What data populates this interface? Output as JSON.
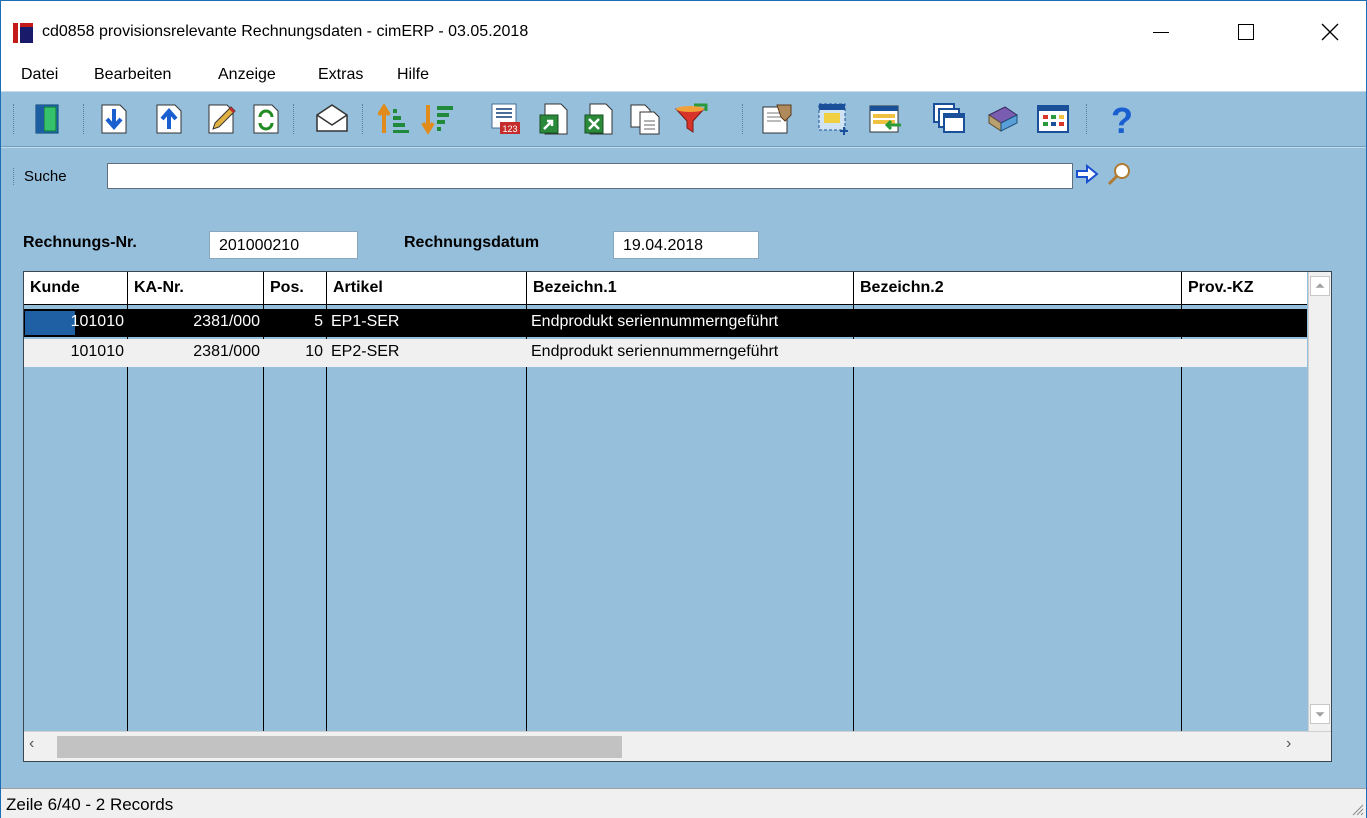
{
  "window": {
    "title": "cd0858 provisionsrelevante Rechnungsdaten - cimERP - 03.05.2018"
  },
  "menu": {
    "items": [
      {
        "label": "Datei"
      },
      {
        "label": "Bearbeiten"
      },
      {
        "label": "Anzeige"
      },
      {
        "label": "Extras"
      },
      {
        "label": "Hilfe"
      }
    ]
  },
  "toolbar": {
    "buttons": [
      {
        "icon": "exit-door-icon"
      },
      {
        "icon": "next-record-down-icon"
      },
      {
        "icon": "previous-record-up-icon"
      },
      {
        "icon": "edit-pencil-icon"
      },
      {
        "icon": "refresh-icon"
      },
      {
        "icon": "email-envelope-icon"
      },
      {
        "icon": "sort-ascending-icon"
      },
      {
        "icon": "sort-descending-icon"
      },
      {
        "icon": "number-format-icon"
      },
      {
        "icon": "export-icon"
      },
      {
        "icon": "excel-export-icon"
      },
      {
        "icon": "copy-documents-icon"
      },
      {
        "icon": "filter-funnel-icon"
      },
      {
        "icon": "record-detail-icon"
      },
      {
        "icon": "new-window-icon"
      },
      {
        "icon": "transfer-list-icon"
      },
      {
        "icon": "cascade-windows-icon"
      },
      {
        "icon": "book-icon"
      },
      {
        "icon": "grid-layout-icon"
      },
      {
        "icon": "help-question-icon"
      }
    ]
  },
  "search": {
    "label": "Suche",
    "value": ""
  },
  "header_fields": {
    "invoice_no_label": "Rechnungs-Nr.",
    "invoice_no_value": "201000210",
    "invoice_date_label": "Rechnungsdatum",
    "invoice_date_value": "19.04.2018"
  },
  "table": {
    "columns": [
      "Kunde",
      "KA-Nr.",
      "Pos.",
      "Artikel",
      "Bezeichn.1",
      "Bezeichn.2",
      "Prov.-KZ"
    ],
    "rows": [
      {
        "kunde": "101010",
        "ka_nr": "2381/000",
        "pos": "5",
        "artikel": "EP1-SER",
        "bez1": "Endprodukt seriennummerngeführt",
        "bez2": "",
        "prov_kz": ""
      },
      {
        "kunde": "101010",
        "ka_nr": "2381/000",
        "pos": "10",
        "artikel": "EP2-SER",
        "bez1": "Endprodukt seriennummerngeführt",
        "bez2": "",
        "prov_kz": ""
      }
    ]
  },
  "statusbar": {
    "text": "Zeile 6/40 - 2 Records"
  },
  "colors": {
    "background": "#96bfdc",
    "selected_row": "#000000",
    "accent": "#1f5fa3"
  }
}
